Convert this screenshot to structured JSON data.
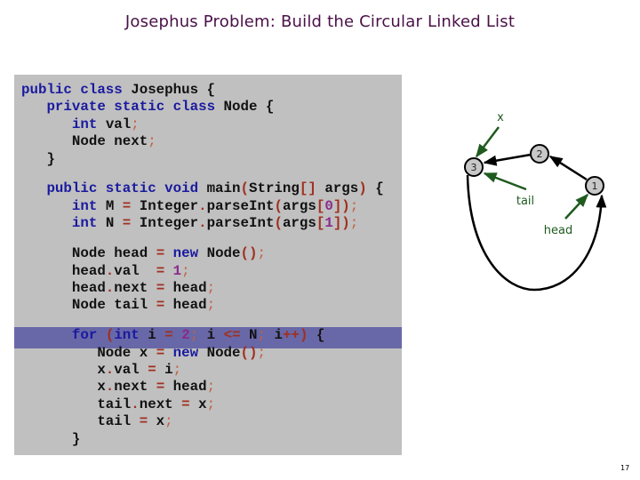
{
  "slide": {
    "title": "Josephus Problem:  Build the Circular Linked List",
    "page_number": "17"
  },
  "code": {
    "language": "java",
    "highlighted_line": "for (int i = 2; i <= N; i++) {",
    "lines": [
      "public class Josephus {",
      "   private static class Node {",
      "      int val;",
      "      Node next;",
      "   }",
      "",
      "   public static void main(String[] args) {",
      "      int M = Integer.parseInt(args[0]);",
      "      int N = Integer.parseInt(args[1]);",
      "",
      "      Node head = new Node();",
      "      head.val  = 1;",
      "      head.next = head;",
      "      Node tail = head;",
      "",
      "      for (int i = 2; i <= N; i++) {",
      "         Node x = new Node();",
      "         x.val = i;",
      "         x.next = head;",
      "         tail.next = x;",
      "         tail = x;",
      "      }"
    ]
  },
  "diagram": {
    "nodes": [
      {
        "id": "n1",
        "label": "1"
      },
      {
        "id": "n2",
        "label": "2"
      },
      {
        "id": "n3",
        "label": "3"
      }
    ],
    "edges": [
      {
        "from": "1",
        "to": "2"
      },
      {
        "from": "2",
        "to": "3"
      },
      {
        "from": "3",
        "to": "1"
      }
    ],
    "pointers": [
      {
        "name": "x",
        "label": "x",
        "points_to": "3"
      },
      {
        "name": "tail",
        "label": "tail",
        "points_to": "3"
      },
      {
        "name": "head",
        "label": "head",
        "points_to": "1"
      }
    ],
    "colors": {
      "node_fill": "#c8c8c8",
      "edge": "#000000",
      "pointer": "#1f5a1f"
    }
  }
}
